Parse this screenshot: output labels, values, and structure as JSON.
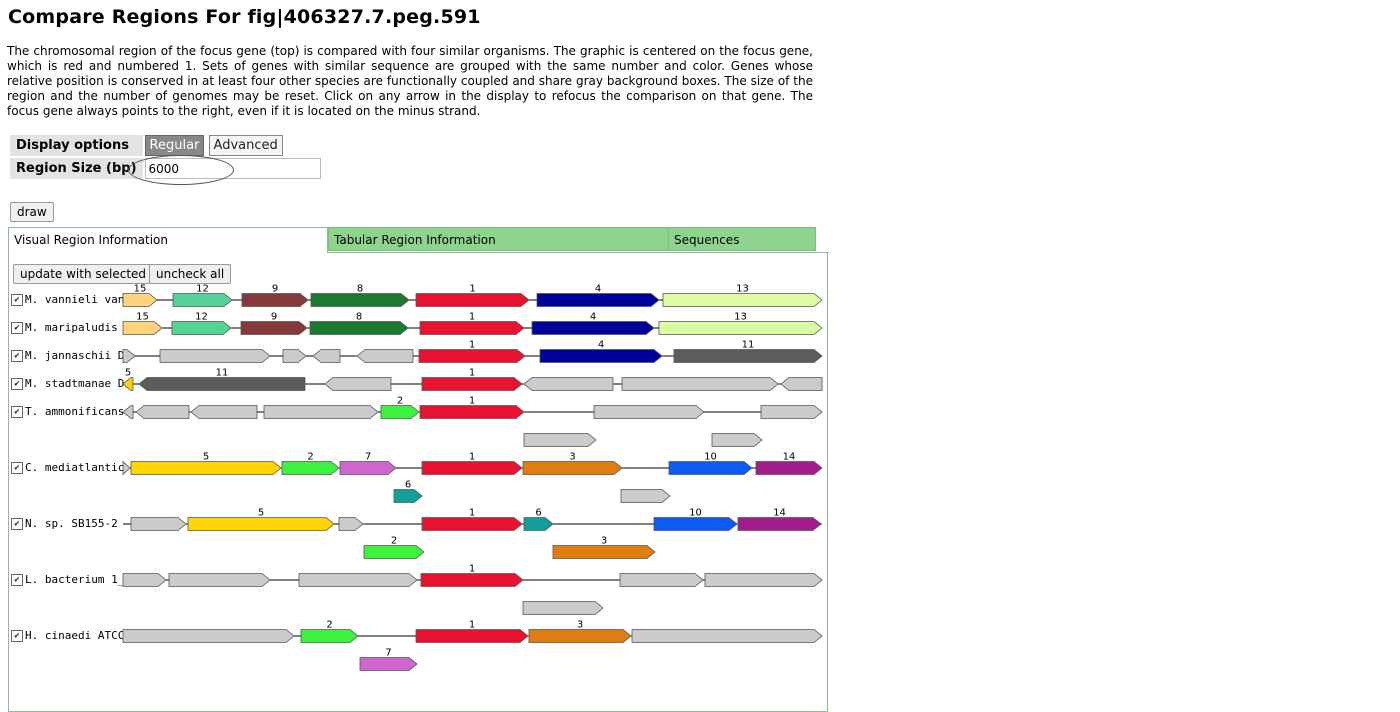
{
  "title": "Compare Regions For fig|406327.7.peg.591",
  "intro": "The chromosomal region of the focus gene (top) is compared with four similar organisms. The graphic is centered on the focus gene, which is red and numbered 1. Sets of genes with similar sequence are grouped with the same number and color. Genes whose relative position is conserved in at least four other species are functionally coupled and share gray background boxes. The size of the region and the number of genomes may be reset. Click on any arrow in the display to refocus the comparison on that gene. The focus gene always points to the right, even if it is located on the minus strand.",
  "options": {
    "display_label": "Display options",
    "regular_label": "Regular",
    "advanced_label": "Advanced",
    "region_label": "Region Size (bp)",
    "region_value": "6000"
  },
  "draw_label": "draw",
  "tabs": {
    "visual": "Visual Region Information",
    "tabular": "Tabular Region Information",
    "sequences": "Sequences"
  },
  "buttons": {
    "update": "update with selected",
    "uncheck": "uncheck all"
  },
  "check_mark": "✔",
  "colors": {
    "1": "#e8132e",
    "2": "#3cf23c",
    "3": "#e07d10",
    "4": "#00039a",
    "5": "#ffd400",
    "6": "#139d9d",
    "7": "#cf66cf",
    "8": "#1a7a32",
    "9": "#843a3a",
    "10": "#0c5bf2",
    "11": "#5c5c5c",
    "12": "#54d494",
    "13": "#dcfca4",
    "14": "#a41c8c",
    "15": "#ffd27e",
    "gray": "#cbcbcb"
  },
  "organisms": [
    {
      "label": "M. vannieli van",
      "genes": [
        {
          "s": 123,
          "e": 157,
          "d": "r",
          "g": "15",
          "l": "15"
        },
        {
          "s": 173,
          "e": 232,
          "d": "r",
          "g": "12",
          "l": "12"
        },
        {
          "s": 242,
          "e": 308,
          "d": "r",
          "g": "9",
          "l": "9"
        },
        {
          "s": 311,
          "e": 409,
          "d": "r",
          "g": "8",
          "l": "8"
        },
        {
          "s": 416,
          "e": 529,
          "d": "r",
          "g": "1",
          "l": "1"
        },
        {
          "s": 537,
          "e": 659,
          "d": "r",
          "g": "4",
          "l": "4"
        },
        {
          "s": 663,
          "e": 822,
          "d": "r",
          "g": "13",
          "l": "13"
        }
      ]
    },
    {
      "label": "M. maripaludis",
      "genes": [
        {
          "s": 123,
          "e": 162,
          "d": "r",
          "g": "15",
          "l": "15"
        },
        {
          "s": 172,
          "e": 231,
          "d": "r",
          "g": "12",
          "l": "12"
        },
        {
          "s": 241,
          "e": 307,
          "d": "r",
          "g": "9",
          "l": "9"
        },
        {
          "s": 310,
          "e": 408,
          "d": "r",
          "g": "8",
          "l": "8"
        },
        {
          "s": 420,
          "e": 524,
          "d": "r",
          "g": "1",
          "l": "1"
        },
        {
          "s": 532,
          "e": 654,
          "d": "r",
          "g": "4",
          "l": "4"
        },
        {
          "s": 659,
          "e": 822,
          "d": "r",
          "g": "13",
          "l": "13"
        }
      ]
    },
    {
      "label": "M. jannaschii D",
      "genes": [
        {
          "s": 123,
          "e": 135,
          "d": "r",
          "g": "gray",
          "l": ""
        },
        {
          "s": 160,
          "e": 270,
          "d": "r",
          "g": "gray",
          "l": ""
        },
        {
          "s": 283,
          "e": 306,
          "d": "r",
          "g": "gray",
          "l": ""
        },
        {
          "s": 313,
          "e": 340,
          "d": "l",
          "g": "gray",
          "l": ""
        },
        {
          "s": 357,
          "e": 413,
          "d": "l",
          "g": "gray",
          "l": ""
        },
        {
          "s": 419,
          "e": 525,
          "d": "r",
          "g": "1",
          "l": "1"
        },
        {
          "s": 540,
          "e": 662,
          "d": "r",
          "g": "4",
          "l": "4"
        },
        {
          "s": 674,
          "e": 822,
          "d": "r",
          "g": "11",
          "l": "11"
        }
      ]
    },
    {
      "label": "M. stadtmanae D",
      "genes": [
        {
          "s": 123,
          "e": 133,
          "d": "l",
          "g": "5",
          "l": "5"
        },
        {
          "s": 139,
          "e": 305,
          "d": "l",
          "g": "11",
          "l": "11"
        },
        {
          "s": 325,
          "e": 391,
          "d": "l",
          "g": "gray",
          "l": ""
        },
        {
          "s": 422,
          "e": 522,
          "d": "r",
          "g": "1",
          "l": "1"
        },
        {
          "s": 524,
          "e": 613,
          "d": "l",
          "g": "gray",
          "l": ""
        },
        {
          "s": 622,
          "e": 778,
          "d": "r",
          "g": "gray",
          "l": ""
        },
        {
          "s": 781,
          "e": 822,
          "d": "l",
          "g": "gray",
          "l": ""
        }
      ]
    },
    {
      "label": "T. ammonificans",
      "genes": [
        {
          "s": 123,
          "e": 133,
          "d": "l",
          "g": "gray",
          "l": ""
        },
        {
          "s": 136,
          "e": 189,
          "d": "l",
          "g": "gray",
          "l": ""
        },
        {
          "s": 191,
          "e": 257,
          "d": "l",
          "g": "gray",
          "l": ""
        },
        {
          "s": 264,
          "e": 378,
          "d": "r",
          "g": "gray",
          "l": ""
        },
        {
          "s": 381,
          "e": 419,
          "d": "r",
          "g": "2",
          "l": "2"
        },
        {
          "s": 420,
          "e": 524,
          "d": "r",
          "g": "1",
          "l": "1"
        },
        {
          "s": 594,
          "e": 704,
          "d": "r",
          "g": "gray",
          "l": ""
        },
        {
          "s": 761,
          "e": 822,
          "d": "r",
          "g": "gray",
          "l": ""
        }
      ]
    },
    {
      "label": "C. mediatlantic",
      "genes": [
        {
          "s": 123,
          "e": 130,
          "d": "r",
          "g": "gray",
          "l": ""
        },
        {
          "s": 131,
          "e": 281,
          "d": "r",
          "g": "5",
          "l": "5"
        },
        {
          "s": 282,
          "e": 339,
          "d": "r",
          "g": "2",
          "l": "2"
        },
        {
          "s": 340,
          "e": 396,
          "d": "r",
          "g": "7",
          "l": "7"
        },
        {
          "s": 422,
          "e": 522,
          "d": "r",
          "g": "1",
          "l": "1"
        },
        {
          "s": 523,
          "e": 622,
          "d": "r",
          "g": "3",
          "l": "3"
        },
        {
          "s": 669,
          "e": 752,
          "d": "r",
          "g": "10",
          "l": "10"
        },
        {
          "s": 756,
          "e": 822,
          "d": "r",
          "g": "14",
          "l": "14"
        }
      ]
    },
    {
      "label": "N. sp. SB155-2",
      "genes": [
        {
          "s": 131,
          "e": 186,
          "d": "r",
          "g": "gray",
          "l": ""
        },
        {
          "s": 188,
          "e": 334,
          "d": "r",
          "g": "5",
          "l": "5"
        },
        {
          "s": 339,
          "e": 363,
          "d": "r",
          "g": "gray",
          "l": ""
        },
        {
          "s": 422,
          "e": 522,
          "d": "r",
          "g": "1",
          "l": "1"
        },
        {
          "s": 524,
          "e": 553,
          "d": "r",
          "g": "6",
          "l": "6"
        },
        {
          "s": 654,
          "e": 737,
          "d": "r",
          "g": "10",
          "l": "10"
        },
        {
          "s": 738,
          "e": 821,
          "d": "r",
          "g": "14",
          "l": "14"
        }
      ]
    },
    {
      "label": "L. bacterium 1_",
      "genes": [
        {
          "s": 123,
          "e": 166,
          "d": "r",
          "g": "gray",
          "l": ""
        },
        {
          "s": 169,
          "e": 270,
          "d": "r",
          "g": "gray",
          "l": ""
        },
        {
          "s": 299,
          "e": 417,
          "d": "r",
          "g": "gray",
          "l": ""
        },
        {
          "s": 421,
          "e": 523,
          "d": "r",
          "g": "1",
          "l": "1"
        },
        {
          "s": 620,
          "e": 703,
          "d": "r",
          "g": "gray",
          "l": ""
        },
        {
          "s": 705,
          "e": 822,
          "d": "r",
          "g": "gray",
          "l": ""
        }
      ]
    },
    {
      "label": "H. cinaedi ATCC",
      "genes": [
        {
          "s": 123,
          "e": 294,
          "d": "r",
          "g": "gray",
          "l": ""
        },
        {
          "s": 301,
          "e": 358,
          "d": "r",
          "g": "2",
          "l": "2"
        },
        {
          "s": 416,
          "e": 528,
          "d": "r",
          "g": "1",
          "l": "1"
        },
        {
          "s": 529,
          "e": 631,
          "d": "r",
          "g": "3",
          "l": "3"
        },
        {
          "s": 632,
          "e": 822,
          "d": "r",
          "g": "gray",
          "l": ""
        }
      ]
    }
  ],
  "extra_genes": [
    {
      "s": 524,
      "e": 596,
      "d": "r",
      "g": "gray",
      "l": "",
      "after": 4
    },
    {
      "s": 712,
      "e": 762,
      "d": "r",
      "g": "gray",
      "l": "",
      "after": 4
    },
    {
      "s": 394,
      "e": 422,
      "d": "r",
      "g": "6",
      "l": "6",
      "after": 5
    },
    {
      "s": 621,
      "e": 670,
      "d": "r",
      "g": "gray",
      "l": "",
      "after": 5
    },
    {
      "s": 364,
      "e": 424,
      "d": "r",
      "g": "2",
      "l": "2",
      "after": 6
    },
    {
      "s": 553,
      "e": 655,
      "d": "r",
      "g": "3",
      "l": "3",
      "after": 6
    },
    {
      "s": 523,
      "e": 603,
      "d": "r",
      "g": "gray",
      "l": "",
      "after": 7
    },
    {
      "s": 360,
      "e": 417,
      "d": "r",
      "g": "7",
      "l": "7",
      "after": 8
    }
  ]
}
